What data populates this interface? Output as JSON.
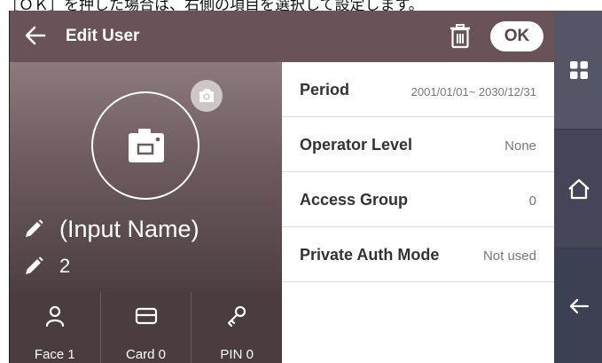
{
  "top_caption": "［ＯＫ］を押した場合は、右側の項目を選択して設定します。",
  "header": {
    "title": "Edit User",
    "ok_label": "OK"
  },
  "profile": {
    "name": "(Input Name)",
    "user_id": "2"
  },
  "auth": [
    {
      "label": "Face 1",
      "icon": "face-icon"
    },
    {
      "label": "Card 0",
      "icon": "card-icon"
    },
    {
      "label": "PIN 0",
      "icon": "key-icon"
    }
  ],
  "settings": [
    {
      "key": "Period",
      "value": "2001/01/01~ 2030/12/31"
    },
    {
      "key": "Operator Level",
      "value": "None"
    },
    {
      "key": "Access Group",
      "value": "0"
    },
    {
      "key": "Private Auth Mode",
      "value": "Not used"
    }
  ],
  "colors": {
    "header_bg": "#6a5358",
    "sidebar_bg": "#3d3f52",
    "auth_bar_bg": "#4a3c3f"
  }
}
